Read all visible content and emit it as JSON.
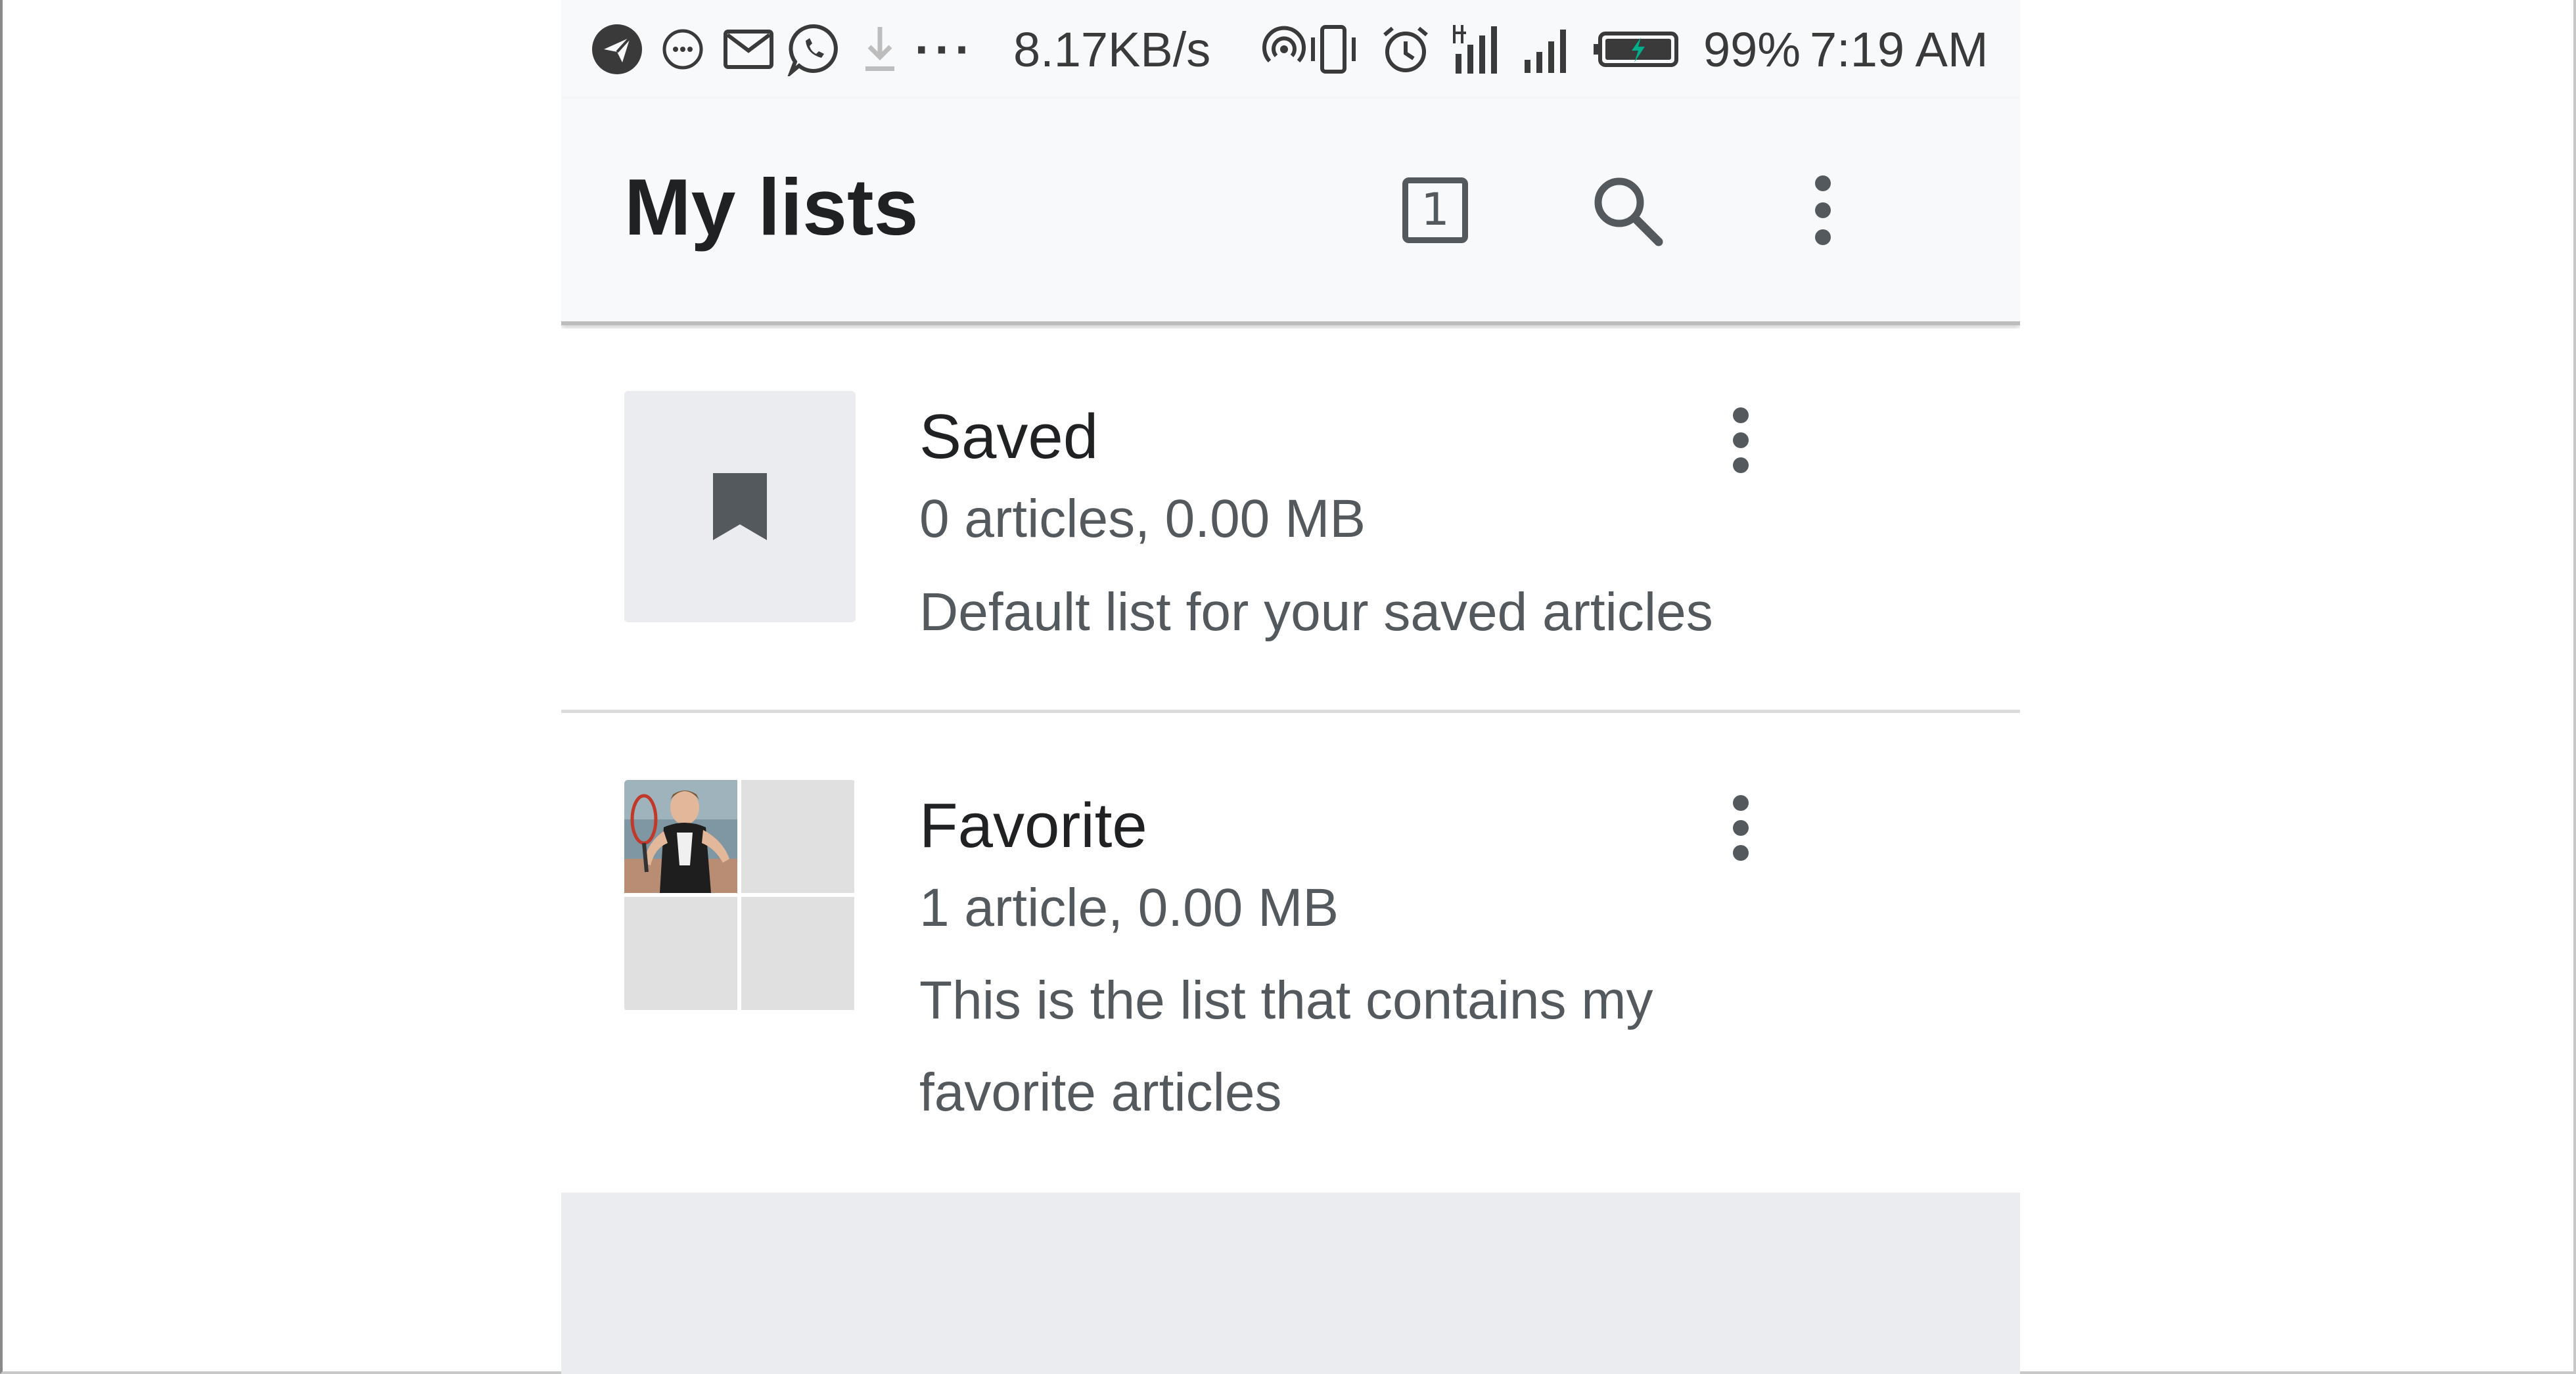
{
  "status_bar": {
    "network_speed": "8.17KB/s",
    "battery_percent": "99%",
    "time": "7:19 AM",
    "left_icons": [
      "telegram-icon",
      "messenger-icon",
      "gmail-icon",
      "whatsapp-icon",
      "download-icon",
      "more-notifications-icon"
    ],
    "right_icons": [
      "hotspot-icon",
      "vibrate-icon",
      "alarm-icon",
      "signal-4g-icon",
      "signal-bars-icon",
      "battery-charging-icon"
    ],
    "more_notifications": "···"
  },
  "app_bar": {
    "title": "My lists",
    "tab_count": "1",
    "actions": [
      "tabs-counter-button",
      "search-button",
      "overflow-menu-button"
    ]
  },
  "lists": [
    {
      "title": "Saved",
      "meta": "0 articles, 0.00 MB",
      "description": "Default list for your saved articles",
      "thumbnail": "bookmark-icon"
    },
    {
      "title": "Favorite",
      "meta": "1 article, 0.00 MB",
      "description": "This is the list that contains my favorite articles",
      "thumbnail": "article-image-grid"
    }
  ],
  "colors": {
    "status_bar_bg": "#f8f9fa",
    "app_bar_bg": "#f8f9fa",
    "primary_text": "#202122",
    "secondary_text": "#54595d",
    "thumb_bg": "#eaecf0",
    "battery_bolt": "#00af89"
  }
}
